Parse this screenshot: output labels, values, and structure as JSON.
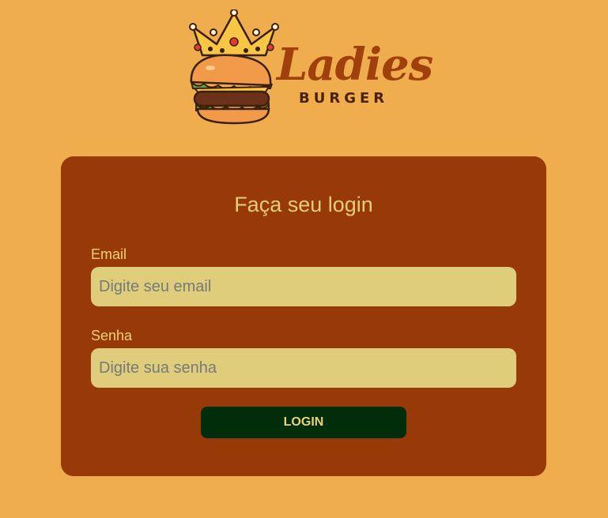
{
  "brand": {
    "name": "Ladies",
    "subtitle": "BURGER",
    "logo_icon": "crowned-burger-icon"
  },
  "login": {
    "title": "Faça seu login",
    "email_label": "Email",
    "email_placeholder": "Digite seu email",
    "email_value": "",
    "password_label": "Senha",
    "password_placeholder": "Digite sua senha",
    "password_value": "",
    "button_label": "LOGIN"
  },
  "colors": {
    "page_background": "#f0ad4e",
    "card_background": "#973a07",
    "input_background": "#dfcd7c",
    "button_background": "#022d0b",
    "accent_text": "#ebd377",
    "brand_text": "#a0410d"
  }
}
